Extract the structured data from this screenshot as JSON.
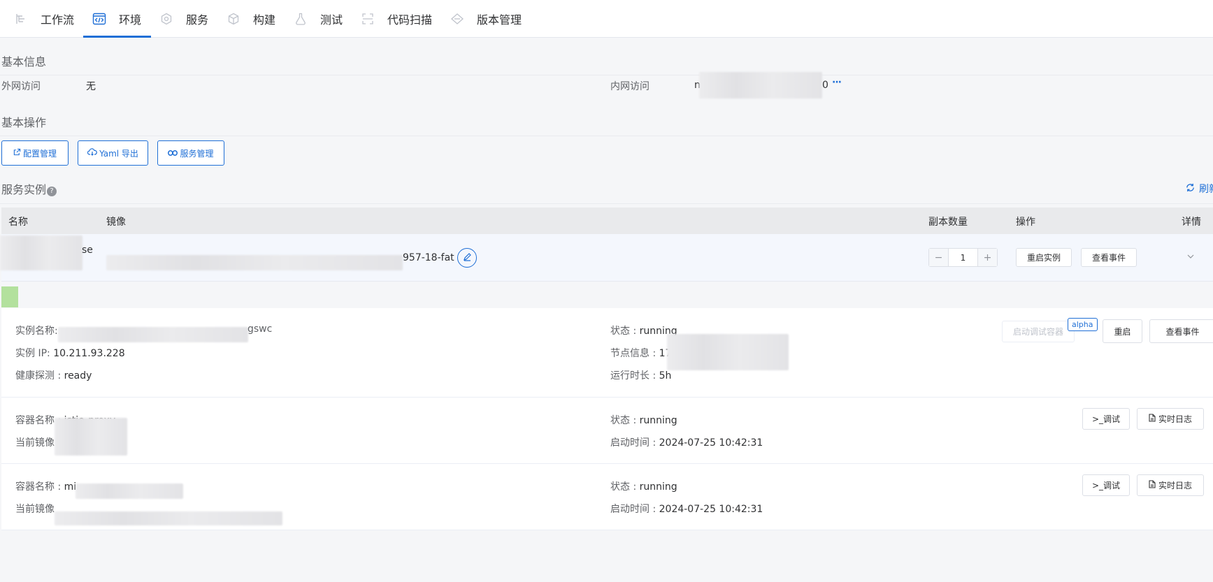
{
  "nav": {
    "items": [
      {
        "label": "工作流",
        "icon": "workflow-icon"
      },
      {
        "label": "环境",
        "icon": "code-icon"
      },
      {
        "label": "服务",
        "icon": "service-icon"
      },
      {
        "label": "构建",
        "icon": "build-icon"
      },
      {
        "label": "测试",
        "icon": "test-flask-icon"
      },
      {
        "label": "代码扫描",
        "icon": "scan-icon"
      },
      {
        "label": "版本管理",
        "icon": "version-icon"
      }
    ],
    "active": "环境"
  },
  "basic_info": {
    "title": "基本信息",
    "external_label": "外网访问",
    "external_value": "无",
    "internal_label": "内网访问",
    "internal_value_start": "n",
    "internal_value_end": "0",
    "more": "···"
  },
  "basic_ops": {
    "title": "基本操作",
    "buttons": [
      {
        "label": "配置管理",
        "icon": "external-link-icon"
      },
      {
        "label": "Yaml 导出",
        "icon": "cloud-download-icon"
      },
      {
        "label": "服务管理",
        "icon": "link-icon"
      }
    ]
  },
  "instances": {
    "title": "服务实例",
    "refresh_label": "刷新",
    "columns": {
      "name": "名称",
      "image": "镜像",
      "replicas": "副本数量",
      "ops": "操作",
      "detail": "详情"
    },
    "row": {
      "name_suffix": "se",
      "image_suffix": "957-18-fat",
      "replicas": "1",
      "minus": "−",
      "plus": "+",
      "restart_label": "重启实例",
      "events_label": "查看事件"
    }
  },
  "pod": {
    "name_label": "实例名称:",
    "name_suffix": "gswc",
    "ip_label": "实例 IP:",
    "ip_value": "10.211.93.228",
    "health_label": "健康探测 :",
    "health_value": "ready",
    "status_label": "状态 :",
    "status_value": "running",
    "node_label": "节点信息 :",
    "node_value": "172",
    "uptime_label": "运行时长 :",
    "uptime_value": "5h",
    "debug_container_label": "启动调试容器",
    "alpha_label": "alpha",
    "restart_label": "重启",
    "events_label": "查看事件"
  },
  "containers": [
    {
      "name_label": "容器名称 :",
      "name_value": "istio-proxy",
      "image_label": "当前镜像",
      "status_label": "状态 :",
      "status_value": "running",
      "start_label": "启动时间 :",
      "start_value": "2024-07-25 10:42:31",
      "debug_label": ">_调试",
      "log_label": "实时日志"
    },
    {
      "name_label": "容器名称 :",
      "name_value": "mi",
      "image_label": "当前镜像",
      "status_label": "状态 :",
      "status_value": "running",
      "start_label": "启动时间 :",
      "start_value": "2024-07-25 10:42:31",
      "debug_label": ">_调试",
      "log_label": "实时日志"
    }
  ]
}
